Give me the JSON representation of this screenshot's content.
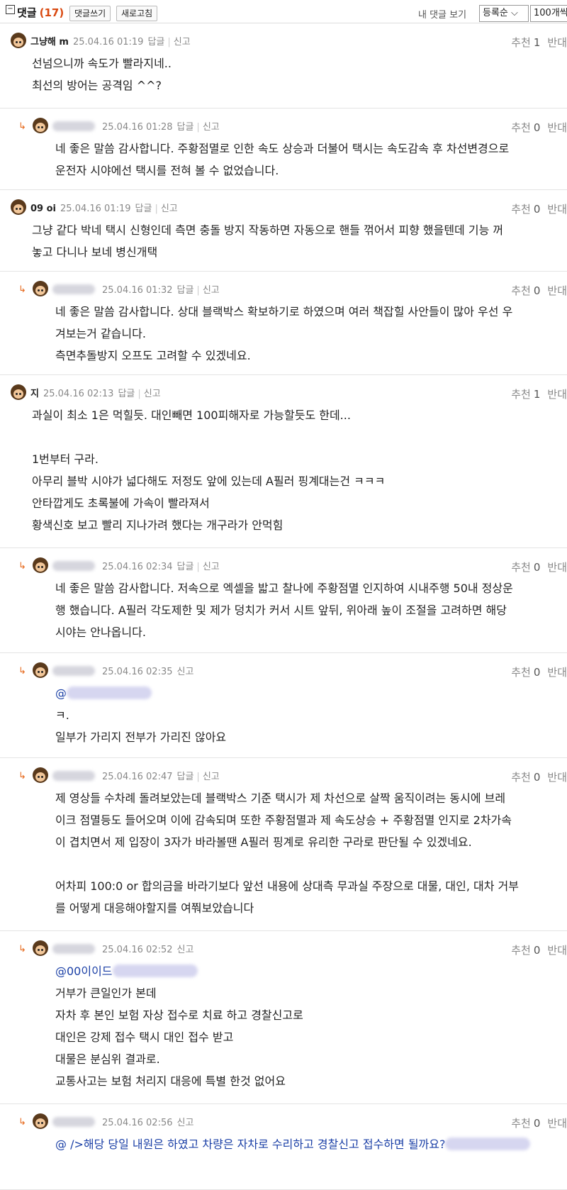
{
  "header": {
    "title": "댓글",
    "count": "(17)",
    "write_label": "댓글쓰기",
    "refresh_label": "새로고침",
    "my_comments_label": "내 댓글 보기",
    "sort_label": "등록순 ⌵",
    "per_page_label": "100개씩"
  },
  "comments": [
    {
      "nick": "그냥해 m",
      "date": "25.04.16 01:19",
      "reply": "답글",
      "report": "신고",
      "rec_label": "추천",
      "rec": "1",
      "against_label": "반대",
      "lines": [
        "선넘으니까 속도가 빨라지네..",
        "최선의 방어는 공격임 ^^?"
      ]
    },
    {
      "nick": "",
      "date": "25.04.16 01:28",
      "reply": "답글",
      "report": "신고",
      "rec_label": "추천",
      "rec": "0",
      "against_label": "반대",
      "lines": [
        "네 좋은 말씀 감사합니다. 주황점멸로 인한 속도 상승과 더불어 택시는 속도감속 후 차선변경으로",
        "운전자 시야에선 택시를 전혀 볼 수 없었습니다."
      ]
    },
    {
      "nick": "09 oi",
      "date": "25.04.16 01:19",
      "reply": "답글",
      "report": "신고",
      "rec_label": "추천",
      "rec": "0",
      "against_label": "반대",
      "lines": [
        "그냥 같다 박네 택시 신형인데 측면 충돌 방지 작동하면 자동으로 핸들 꺾어서 피향 했을텐데 기능 꺼",
        "놓고 다니나 보네 병신개택"
      ]
    },
    {
      "nick": "",
      "date": "25.04.16 01:32",
      "reply": "답글",
      "report": "신고",
      "rec_label": "추천",
      "rec": "0",
      "against_label": "반대",
      "lines": [
        "네 좋은 말씀 감사합니다. 상대 블랙박스 확보하기로 하였으며 여러 책잡힐 사안들이 많아 우선 우",
        "겨보는거 같습니다.",
        "측면추돌방지 오프도 고려할 수 있겠네요."
      ]
    },
    {
      "nick": "지",
      "date": "25.04.16 02:13",
      "reply": "답글",
      "report": "신고",
      "rec_label": "추천",
      "rec": "1",
      "against_label": "반대",
      "lines": [
        "과실이 최소 1은 먹힐듯. 대인빼면 100피해자로 가능할듯도 한데...",
        "",
        "1번부터 구라.",
        "아무리 블박 시야가 넓다해도 저정도 앞에 있는데 A필러 핑계대는건 ㅋㅋㅋ",
        "안타깝게도 초록불에 가속이 빨라져서",
        "황색신호 보고 빨리 지나가려 했다는 개구라가 안먹힘"
      ]
    },
    {
      "nick": "",
      "date": "25.04.16 02:34",
      "reply": "답글",
      "report": "신고",
      "rec_label": "추천",
      "rec": "0",
      "against_label": "반대",
      "lines": [
        "네 좋은 말씀 감사합니다. 저속으로 엑셀을 밟고 찰나에 주황점멸 인지하여 시내주행 50내 정상운",
        "행 했습니다. A필러 각도제한 및 제가 덩치가 커서 시트 앞뒤, 위아래 높이 조절을 고려하면 해당",
        "시야는 안나옵니다."
      ]
    },
    {
      "nick": "",
      "date": "25.04.16 02:35",
      "reply": "",
      "report": "신고",
      "rec_label": "추천",
      "rec": "0",
      "against_label": "반대",
      "lines": [
        "@",
        "ㅋ.",
        "일부가 가리지 전부가 가리진 않아요"
      ]
    },
    {
      "nick": "",
      "date": "25.04.16 02:47",
      "reply": "답글",
      "report": "신고",
      "rec_label": "추천",
      "rec": "0",
      "against_label": "반대",
      "lines": [
        "제 영상들 수차례 돌려보았는데 블랙박스 기준 택시가 제 차선으로 살짝 움직이려는 동시에 브레",
        "이크 점멸등도 들어오며 이에 감속되며 또한 주황점멸과 제 속도상승 + 주황점멸 인지로 2차가속",
        "이 겹치면서 제 입장이 3자가 바라볼땐 A필러 핑계로 유리한 구라로 판단될 수 있겠네요.",
        "",
        "어차피 100:0 or 합의금을 바라기보다 앞선 내용에 상대측 무과실 주장으로 대물, 대인, 대차 거부",
        "를 어떻게 대응해야할지를 여쭤보았습니다"
      ]
    },
    {
      "nick": "",
      "date": "25.04.16 02:52",
      "reply": "",
      "report": "신고",
      "rec_label": "추천",
      "rec": "0",
      "against_label": "반대",
      "lines": [
        "@00이이드",
        "거부가 큰일인가 본데",
        "자차 후 본인 보험 자상 접수로 치료 하고 경찰신고로",
        "대인은 강제 접수 택시 대인 접수 받고",
        "대물은 분심위 결과로.",
        "교통사고는 보험 처리지 대응에 특별 한것 없어요"
      ]
    },
    {
      "nick": "",
      "date": "25.04.16 02:56",
      "reply": "",
      "report": "신고",
      "rec_label": "추천",
      "rec": "0",
      "against_label": "반대",
      "lines": [
        "@ />해당 당일 내원은 하였고 차량은 자차로 수리하고 경찰신고 접수하면 될까요?"
      ]
    }
  ]
}
